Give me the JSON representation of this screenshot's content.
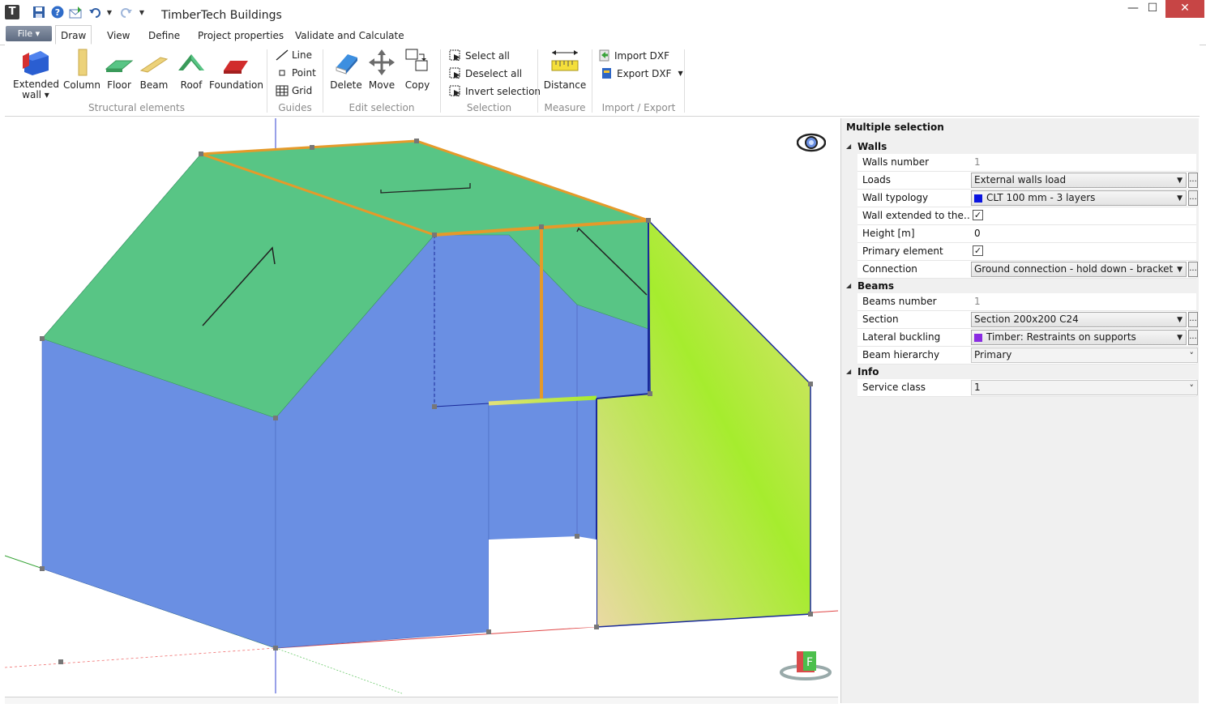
{
  "app": {
    "title": "TimberTech Buildings",
    "icon_letter": "T"
  },
  "window_buttons": {
    "minimize": "—",
    "maximize": "☐",
    "close": "✕"
  },
  "menu": {
    "file_label": "File ▾",
    "tabs": [
      "Draw",
      "View",
      "Define",
      "Project properties",
      "Validate and Calculate"
    ],
    "active_tab": "Draw"
  },
  "ribbon": {
    "structural": {
      "group_label": "Structural elements",
      "buttons": [
        "Extended\nwall ▾",
        "Column",
        "Floor",
        "Beam",
        "Roof",
        "Foundation"
      ]
    },
    "guides": {
      "group_label": "Guides",
      "items": [
        "Line",
        "Point",
        "Grid"
      ]
    },
    "edit": {
      "group_label": "Edit selection",
      "buttons": [
        "Delete",
        "Move",
        "Copy"
      ]
    },
    "selection": {
      "group_label": "Selection",
      "items": [
        "Select all",
        "Deselect all",
        "Invert selection"
      ]
    },
    "measure": {
      "group_label": "Measure",
      "button": "Distance"
    },
    "import_export": {
      "group_label": "Import / Export",
      "items": [
        "Import DXF",
        "Export DXF"
      ]
    }
  },
  "viewport": {
    "colors": {
      "wall": "#6a8fe3",
      "roof": "#58c585",
      "beam": "#e59a2a",
      "selected_gradient_a": "#e3dd9a",
      "selected_gradient_b": "#a6ec2e"
    },
    "cube_label": "F"
  },
  "properties": {
    "title": "Multiple selection",
    "categories": [
      {
        "name": "Walls",
        "rows": [
          {
            "name": "Walls number",
            "type": "readonly",
            "value": "1"
          },
          {
            "name": "Loads",
            "type": "dropdown",
            "value": "External walls load",
            "ellipsis": true
          },
          {
            "name": "Wall typology",
            "type": "dropdown",
            "value": "CLT 100 mm - 3 layers",
            "swatch": "#0a14e0",
            "ellipsis": true
          },
          {
            "name": "Wall extended to the fl...",
            "type": "checkbox",
            "value": "✓"
          },
          {
            "name": "Height [m]",
            "type": "text",
            "value": "0"
          },
          {
            "name": "Primary element",
            "type": "checkbox",
            "value": "✓"
          },
          {
            "name": "Connection",
            "type": "dropdown",
            "value": "Ground connection - hold down - bracket",
            "ellipsis": true
          }
        ]
      },
      {
        "name": "Beams",
        "rows": [
          {
            "name": "Beams number",
            "type": "readonly",
            "value": "1"
          },
          {
            "name": "Section",
            "type": "dropdown",
            "value": "Section 200x200 C24",
            "ellipsis": true
          },
          {
            "name": "Lateral buckling",
            "type": "dropdown",
            "value": "Timber: Restraints on supports",
            "swatch": "#8a2be2",
            "ellipsis": true
          },
          {
            "name": "Beam hierarchy",
            "type": "combo",
            "value": "Primary"
          }
        ]
      },
      {
        "name": "Info",
        "rows": [
          {
            "name": "Service class",
            "type": "combo",
            "value": "1"
          }
        ]
      }
    ]
  }
}
